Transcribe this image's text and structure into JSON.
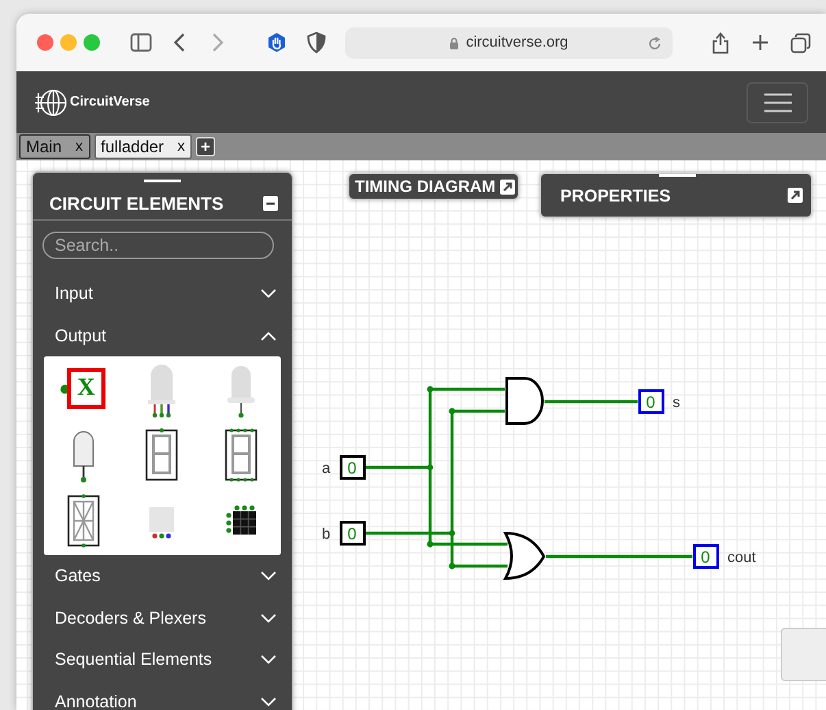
{
  "browser": {
    "url": "circuitverse.org"
  },
  "brand": "CircuitVerse",
  "tabs": [
    {
      "label": "Main",
      "close": "x",
      "selected": false
    },
    {
      "label": "fulladder",
      "close": "x",
      "selected": true
    }
  ],
  "new_tab": "+",
  "elements_panel": {
    "title": "CIRCUIT ELEMENTS",
    "search": {
      "placeholder": "Search.."
    },
    "categories": [
      {
        "label": "Input",
        "expanded": false
      },
      {
        "label": "Output",
        "expanded": true,
        "items": [
          {
            "kind": "probe",
            "text": "X"
          },
          {
            "kind": "rgb-led"
          },
          {
            "kind": "led"
          },
          {
            "kind": "variable-led"
          },
          {
            "kind": "seven-segment"
          },
          {
            "kind": "hex-display"
          },
          {
            "kind": "sixteen-segment"
          },
          {
            "kind": "square-rgb-led"
          },
          {
            "kind": "led-matrix"
          }
        ]
      },
      {
        "label": "Gates",
        "expanded": false
      },
      {
        "label": "Decoders & Plexers",
        "expanded": false
      },
      {
        "label": "Sequential Elements",
        "expanded": false
      },
      {
        "label": "Annotation",
        "expanded": false
      }
    ]
  },
  "timing_diagram": {
    "title": "TIMING DIAGRAM"
  },
  "properties": {
    "title": "PROPERTIES"
  },
  "circuit": {
    "inputs": [
      {
        "label": "a",
        "value": "0"
      },
      {
        "label": "b",
        "value": "0"
      }
    ],
    "outputs": [
      {
        "label": "s",
        "value": "0"
      },
      {
        "label": "cout",
        "value": "0"
      }
    ]
  }
}
